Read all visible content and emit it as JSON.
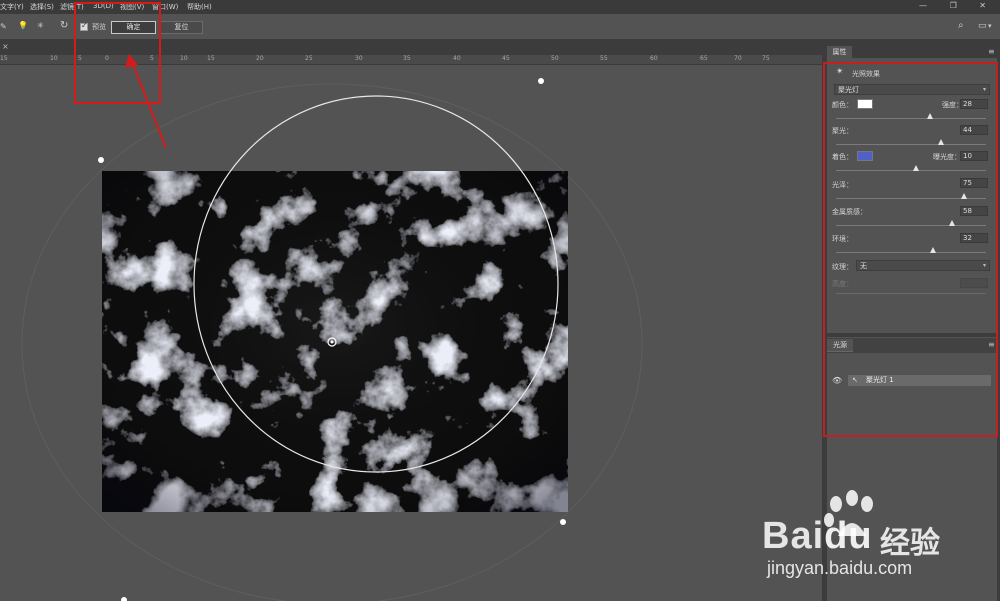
{
  "menu": [
    "文字(Y)",
    "选择(S)",
    "滤镜(T)",
    "3D(D)",
    "视图(V)",
    "窗口(W)",
    "帮助(H)"
  ],
  "window_controls": "— ❐ ✕",
  "options": {
    "preview_label": "预览",
    "ok_label": "确定",
    "reset_label": "复位"
  },
  "doc_close": "×",
  "ruler_labels": [
    "15",
    "10",
    "5",
    "0",
    "5",
    "10",
    "15",
    "20",
    "25",
    "30",
    "35",
    "40",
    "45",
    "50",
    "55",
    "60",
    "65",
    "70",
    "75"
  ],
  "properties": {
    "tab": "属性",
    "effect_title": "光照效果",
    "light_type": "聚光灯",
    "color_label": "颜色：",
    "color_value": "#ffffff",
    "intensity_label": "强度：",
    "intensity": 28,
    "hotspot_label": "聚光：",
    "hotspot": 44,
    "colorize_label": "着色：",
    "colorize_value": "#5060c8",
    "exposure_label": "曝光度：",
    "exposure": 10,
    "gloss_label": "光泽：",
    "gloss": 75,
    "metallic_label": "金属质感：",
    "metallic": 58,
    "ambience_label": "环境：",
    "ambience": 32,
    "texture_label": "纹理：",
    "texture": "无",
    "height_label": "高度："
  },
  "lights": {
    "tab": "光源",
    "items": [
      {
        "name": "聚光灯 1"
      }
    ]
  },
  "watermark": {
    "brand": "Bai",
    "brand2": "du",
    "cn": "经验",
    "url": "jingyan.baidu.com"
  },
  "colors": {
    "annotation_red": "#d61a1a",
    "panel_bg": "#535353",
    "dark_bg": "#3c3c3c"
  }
}
